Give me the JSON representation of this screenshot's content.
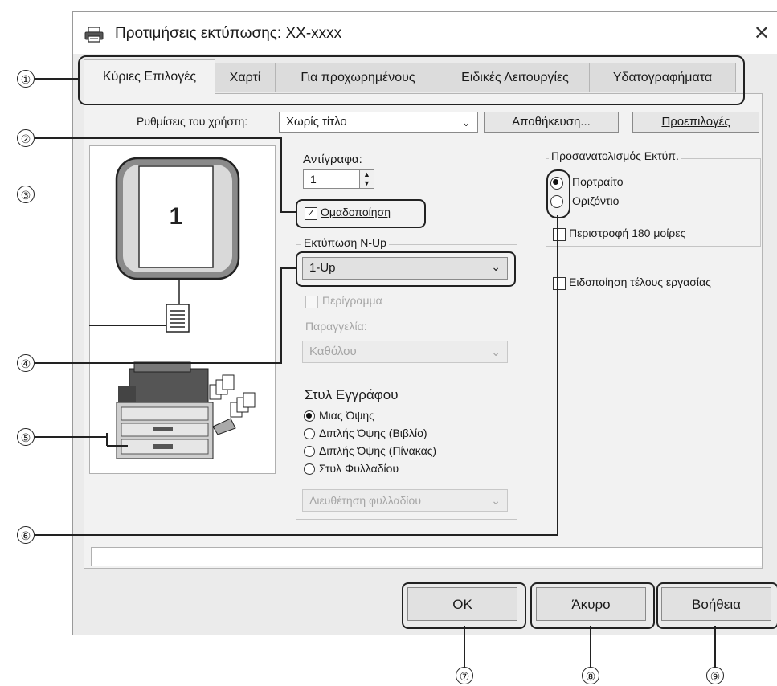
{
  "window": {
    "title": "Προτιμήσεις εκτύπωσης: XX-xxxx",
    "close_glyph": "✕"
  },
  "tabs": [
    {
      "label": "Κύριες Επιλογές"
    },
    {
      "label": "Χαρτί"
    },
    {
      "label": "Για προχωρημένους"
    },
    {
      "label": "Ειδικές Λειτουργίες"
    },
    {
      "label": "Υδατογραφήματα"
    }
  ],
  "user_settings": {
    "label": "Ρυθμίσεις του χρήστη:",
    "value": "Χωρίς τίτλο",
    "save_label": "Αποθήκευση...",
    "defaults_label": "Προεπιλογές"
  },
  "preview": {
    "page_number": "1"
  },
  "copies": {
    "label": "Αντίγραφα:",
    "value": "1"
  },
  "collate": {
    "label": "Ομαδοποίηση",
    "checked": true
  },
  "nup": {
    "group_label": "Εκτύπωση N-Up",
    "value": "1-Up",
    "border_label": "Περίγραμμα",
    "order_label": "Παραγγελία:",
    "order_value": "Καθόλου"
  },
  "document_style": {
    "group_label": "Στυλ Εγγράφου",
    "options": [
      {
        "label": "Μιας Όψης",
        "selected": true
      },
      {
        "label": "Διπλής Όψης (Βιβλίο)",
        "selected": false
      },
      {
        "label": "Διπλής Όψης (Πίνακας)",
        "selected": false
      },
      {
        "label": "Στυλ Φυλλαδίου",
        "selected": false
      }
    ],
    "booklet_value": "Διευθέτηση φυλλαδίου"
  },
  "orientation": {
    "group_label": "Προσανατολισμός Εκτύπ.",
    "portrait_label": "Πορτραίτο",
    "landscape_label": "Οριζόντιο",
    "rotate_label": "Περιστροφή 180 μοίρες"
  },
  "job_end_notice": {
    "label": "Ειδοποίηση τέλους εργασίας"
  },
  "footer_buttons": {
    "ok": "OK",
    "cancel": "Άκυρο",
    "help": "Βοήθεια"
  },
  "callouts": [
    "①",
    "②",
    "③",
    "④",
    "⑤",
    "⑥",
    "⑦",
    "⑧",
    "⑨"
  ]
}
